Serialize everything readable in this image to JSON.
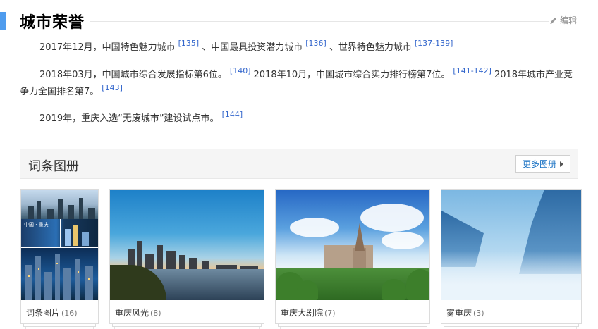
{
  "section": {
    "title": "城市荣誉",
    "edit_label": "编辑"
  },
  "paragraphs": {
    "p1": {
      "t1": "2017年12月，中国特色魅力城市",
      "r1": "[135]",
      "t2": "、中国最具投资潜力城市",
      "r2": "[136]",
      "t3": "、世界特色魅力城市",
      "r3": "[137-139]"
    },
    "p2": {
      "t1": "2018年03月，中国城市综合发展指标第6位。",
      "r1": "[140]",
      "t2": "2018年10月，中国城市综合实力排行榜第7位。",
      "r2": "[141-142]",
      "t3": "2018年城市产业竞争力全国排名第7。",
      "r3": "[143]"
    },
    "p3": {
      "t1": "2019年，重庆入选“无废城市”建设试点市。",
      "r1": "[144]"
    }
  },
  "album": {
    "title": "词条图册",
    "more_label": "更多图册",
    "cards": [
      {
        "name": "词条图片",
        "count": "(16)",
        "icon": "collage-image"
      },
      {
        "name": "重庆风光",
        "count": "(8)",
        "icon": "city-skyline-image"
      },
      {
        "name": "重庆大剧院",
        "count": "(7)",
        "icon": "church-image"
      },
      {
        "name": "雾重庆",
        "count": "(3)",
        "icon": "foggy-mountains-image"
      }
    ]
  },
  "colors": {
    "accent_bar": "#4f9cee",
    "link": "#3366cc",
    "more_link": "#136ec2"
  }
}
